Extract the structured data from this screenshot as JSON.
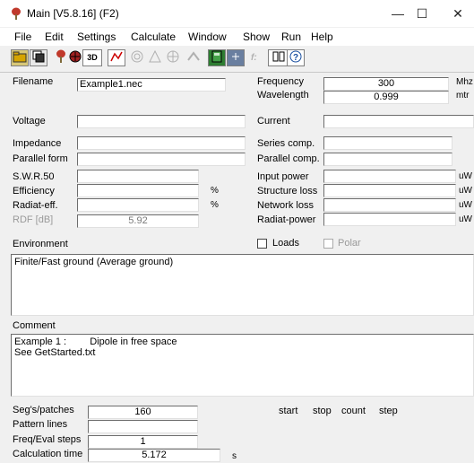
{
  "window": {
    "title": "Main [V5.8.16]  (F2)",
    "minimize": "—",
    "maximize": "☐",
    "close": "✕"
  },
  "menu": [
    "File",
    "Edit",
    "Settings",
    "Calculate",
    "Window",
    "Show",
    "Run",
    "Help"
  ],
  "toolbar": {
    "view3d_label": "3D"
  },
  "left": {
    "filename_label": "Filename",
    "filename_value": "Example1.nec",
    "voltage_label": "Voltage",
    "voltage_value": "",
    "impedance_label": "Impedance",
    "impedance_value": "",
    "parallel_form_label": "Parallel form",
    "parallel_form_value": "",
    "swr_label": "S.W.R.50",
    "swr_value": "",
    "efficiency_label": "Efficiency",
    "efficiency_value": "",
    "efficiency_unit": "%",
    "radiat_eff_label": "Radiat-eff.",
    "radiat_eff_value": "",
    "radiat_eff_unit": "%",
    "rdf_label": "RDF [dB]",
    "rdf_value": "5.92"
  },
  "right": {
    "frequency_label": "Frequency",
    "frequency_value": "300",
    "frequency_unit": "Mhz",
    "wavelength_label": "Wavelength",
    "wavelength_value": "0.999",
    "wavelength_unit": "mtr",
    "current_label": "Current",
    "current_value": "",
    "series_comp_label": "Series comp.",
    "series_comp_value": "",
    "parallel_comp_label": "Parallel comp.",
    "parallel_comp_value": "",
    "input_power_label": "Input power",
    "input_power_value": "",
    "input_power_unit": "uW",
    "structure_loss_label": "Structure loss",
    "structure_loss_value": "",
    "structure_loss_unit": "uW",
    "network_loss_label": "Network loss",
    "network_loss_value": "",
    "network_loss_unit": "uW",
    "radiat_power_label": "Radiat-power",
    "radiat_power_value": "",
    "radiat_power_unit": "uW"
  },
  "environment": {
    "label": "Environment",
    "loads_label": "Loads",
    "polar_label": "Polar",
    "text": "Finite/Fast ground (Average ground)"
  },
  "comment": {
    "label": "Comment",
    "line1_a": "Example 1 :",
    "line1_b": "Dipole in free space",
    "line2": "See GetStarted.txt"
  },
  "bottom": {
    "segs_label": "Seg's/patches",
    "segs_value": "160",
    "pattern_label": "Pattern lines",
    "pattern_value": "",
    "freq_steps_label": "Freq/Eval steps",
    "freq_steps_value": "1",
    "calc_time_label": "Calculation time",
    "calc_time_value": "5.172",
    "calc_time_unit": "s",
    "start_label": "start",
    "stop_label": "stop",
    "count_label": "count",
    "step_label": "step"
  }
}
